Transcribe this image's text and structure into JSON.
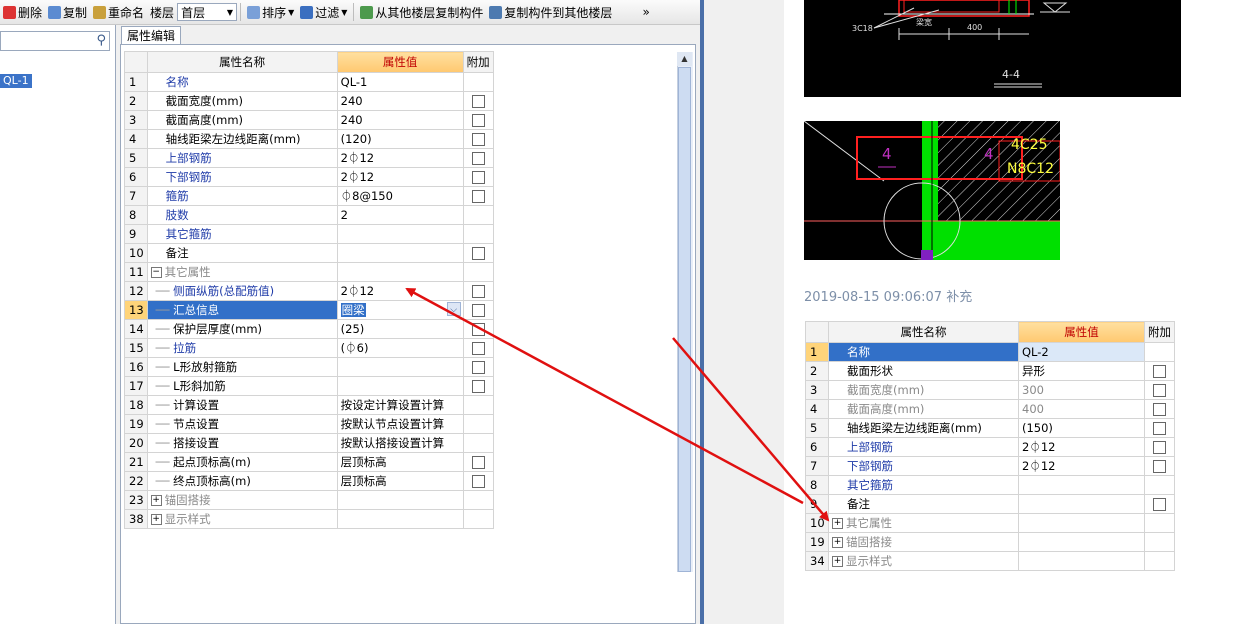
{
  "toolbar": {
    "delete": "删除",
    "copy": "复制",
    "rename": "重命名",
    "floor_label": "楼层",
    "floor_value": "首层",
    "sort": "排序",
    "filter": "过滤",
    "copy_from_floor": "从其他楼层复制构件",
    "copy_to_floor": "复制构件到其他楼层",
    "more": "»"
  },
  "left_tree": {
    "selected_item": "QL-1"
  },
  "tab": {
    "label": "属性编辑"
  },
  "grid": {
    "col_name": "属性名称",
    "col_value": "属性值",
    "col_extra": "附加",
    "rows": [
      {
        "num": "1",
        "name": "名称",
        "value": "QL-1",
        "style": "blue",
        "check": false,
        "level": 0
      },
      {
        "num": "2",
        "name": "截面宽度(mm)",
        "value": "240",
        "style": "black",
        "check": true,
        "level": 0
      },
      {
        "num": "3",
        "name": "截面高度(mm)",
        "value": "240",
        "style": "black",
        "check": true,
        "level": 0
      },
      {
        "num": "4",
        "name": "轴线距梁左边线距离(mm)",
        "value": "(120)",
        "style": "black",
        "check": true,
        "level": 0
      },
      {
        "num": "5",
        "name": "上部钢筋",
        "value": "2⏀12",
        "style": "blue",
        "check": true,
        "level": 0
      },
      {
        "num": "6",
        "name": "下部钢筋",
        "value": "2⏀12",
        "style": "blue",
        "check": true,
        "level": 0
      },
      {
        "num": "7",
        "name": "箍筋",
        "value": "⏀8@150",
        "style": "blue",
        "check": true,
        "level": 0
      },
      {
        "num": "8",
        "name": "肢数",
        "value": "2",
        "style": "blue",
        "check": false,
        "level": 0
      },
      {
        "num": "9",
        "name": "其它箍筋",
        "value": "",
        "style": "blue",
        "check": false,
        "level": 0
      },
      {
        "num": "10",
        "name": "备注",
        "value": "",
        "style": "black",
        "check": true,
        "level": 0
      },
      {
        "num": "11",
        "name": "其它属性",
        "value": "",
        "style": "gray",
        "check": false,
        "level": 0,
        "expander": "−"
      },
      {
        "num": "12",
        "name": "侧面纵筋(总配筋值)",
        "value": "2⏀12",
        "style": "blue",
        "check": true,
        "level": 1
      },
      {
        "num": "13",
        "name": "汇总信息",
        "value": "圈梁",
        "style": "blue",
        "check": true,
        "level": 1,
        "selected": true
      },
      {
        "num": "14",
        "name": "保护层厚度(mm)",
        "value": "(25)",
        "style": "black",
        "check": true,
        "level": 1
      },
      {
        "num": "15",
        "name": "拉筋",
        "value": "(⏀6)",
        "style": "blue",
        "check": true,
        "level": 1
      },
      {
        "num": "16",
        "name": "L形放射箍筋",
        "value": "",
        "style": "black",
        "check": true,
        "level": 1
      },
      {
        "num": "17",
        "name": "L形斜加筋",
        "value": "",
        "style": "black",
        "check": true,
        "level": 1
      },
      {
        "num": "18",
        "name": "计算设置",
        "value": "按设定计算设置计算",
        "style": "black",
        "check": false,
        "level": 1
      },
      {
        "num": "19",
        "name": "节点设置",
        "value": "按默认节点设置计算",
        "style": "black",
        "check": false,
        "level": 1
      },
      {
        "num": "20",
        "name": "搭接设置",
        "value": "按默认搭接设置计算",
        "style": "black",
        "check": false,
        "level": 1
      },
      {
        "num": "21",
        "name": "起点顶标高(m)",
        "value": "层顶标高",
        "style": "black",
        "check": true,
        "level": 1
      },
      {
        "num": "22",
        "name": "终点顶标高(m)",
        "value": "层顶标高",
        "style": "black",
        "check": true,
        "level": 1
      },
      {
        "num": "23",
        "name": "锚固搭接",
        "value": "",
        "style": "gray",
        "check": false,
        "level": 0,
        "expander": "+"
      },
      {
        "num": "38",
        "name": "显示样式",
        "value": "",
        "style": "gray",
        "check": false,
        "level": 0,
        "expander": "+"
      }
    ]
  },
  "cad1": {
    "section_label": "4-4",
    "dim1": "3C18",
    "dim2": "400",
    "dim3": "梁宽"
  },
  "cad2": {
    "label_a": "4",
    "label_b": "4",
    "text_a": "4C25",
    "text_b": "N8C12"
  },
  "post": {
    "timestamp": "2019-08-15 09:06:07",
    "suffix": "补充"
  },
  "rgrid": {
    "col_name": "属性名称",
    "col_value": "属性值",
    "col_extra": "附加",
    "rows": [
      {
        "num": "1",
        "name": "名称",
        "value": "QL-2",
        "style": "blue",
        "check": false,
        "selected": true
      },
      {
        "num": "2",
        "name": "截面形状",
        "value": "异形",
        "style": "black",
        "check": true
      },
      {
        "num": "3",
        "name": "截面宽度(mm)",
        "value": "300",
        "style": "gray",
        "check": true
      },
      {
        "num": "4",
        "name": "截面高度(mm)",
        "value": "400",
        "style": "gray",
        "check": true
      },
      {
        "num": "5",
        "name": "轴线距梁左边线距离(mm)",
        "value": "(150)",
        "style": "black",
        "check": true
      },
      {
        "num": "6",
        "name": "上部钢筋",
        "value": "2⏀12",
        "style": "blue",
        "check": true
      },
      {
        "num": "7",
        "name": "下部钢筋",
        "value": "2⏀12",
        "style": "blue",
        "check": true
      },
      {
        "num": "8",
        "name": "其它箍筋",
        "value": "",
        "style": "blue",
        "check": false
      },
      {
        "num": "9",
        "name": "备注",
        "value": "",
        "style": "black",
        "check": true
      },
      {
        "num": "10",
        "name": "其它属性",
        "value": "",
        "style": "gray",
        "check": false,
        "expander": "+"
      },
      {
        "num": "19",
        "name": "锚固搭接",
        "value": "",
        "style": "gray",
        "check": false,
        "expander": "+"
      },
      {
        "num": "34",
        "name": "显示样式",
        "value": "",
        "style": "gray",
        "check": false,
        "expander": "+"
      }
    ]
  },
  "colors": {
    "accent": "#3270c8",
    "header_value": "#ffc870",
    "arrow": "#e01010"
  }
}
